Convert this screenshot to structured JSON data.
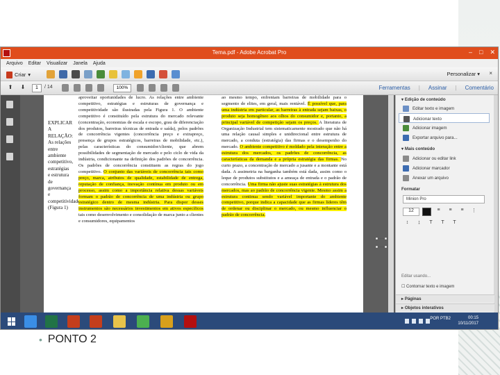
{
  "window": {
    "title": "Tema.pdf - Adobe Acrobat Pro"
  },
  "menu": [
    "Arquivo",
    "Editar",
    "Visualizar",
    "Janela",
    "Ajuda"
  ],
  "toolbar": {
    "create_label": "Criar",
    "personalize_label": "Personalizar",
    "close_symbol": "×"
  },
  "navigation": {
    "page_number": "1",
    "page_total": "/ 14",
    "zoom": "100%"
  },
  "panel_tabs": [
    "Ferramentas",
    "Assinar",
    "Comentário"
  ],
  "right_panel": {
    "section_edit": "Edição de conteúdo",
    "edit_items": [
      "Editar texto e imagem",
      "Adicionar texto",
      "Adicionar imagem",
      "Exportar arquivo para..."
    ],
    "section_more": "Mais conteúdo",
    "more_items": [
      "Adicionar ou editar link",
      "Adicionar marcador",
      "Anexar um arquivo"
    ],
    "format_label": "Formatar",
    "font_name": "Minion Pro",
    "font_size": "12",
    "aux_label": "Editar usando...",
    "constrain_label": "Contornar texto e imagem",
    "section_pages": "Páginas",
    "section_interactive": "Objetos interativos"
  },
  "document": {
    "side_label": "EXPLICAR A RELAÇÃO: As relações entre ambiente competitivo, estratégias e estrutura de governança e competitividade (Figura 1)",
    "col_a": [
      {
        "t": "aproveitar oportunidades de lucro.",
        "h": false
      },
      {
        "t": "As relações entre ambiente competitivo, estratégias e estruturas de governança e competitividade são ilustradas pela Figura 1. O ambiente competitivo é constituído pela estrutura do mercado relevante (concentração, economias de escala e escopo, grau de diferenciação dos produtos, barreiras técnicas de entrada e saída), pelos padrões de concorrência vigentes (concorrência preço e extrapreço, presença de grupos estratégicos, barreiras de mobilidade, etc.), pelas características do consumidor/cliente, que abrem possibilidades de segmentação de mercado e pelo ciclo de vida da indústria, condicionante na definição dos padrões de concorrência.",
        "h": false
      },
      {
        "t": "Os padrões de concorrência constituem as regras do jogo competitivo.",
        "h": false
      },
      {
        "t": "O conjunto das variáveis de concorrência tais como preço, marca, atributos de qualidade, estabilidade de entrega, reputação de confiança, inovação contínua em produto ou em processo, assim como a importância relativa dessas variáveis formam o padrão de concorrência de uma indústria ou grupo estratégico dentro de mesma indústria.",
        "h": true
      },
      {
        "t": "Para dispor desses instrumentos são necessários investimentos em ativos específicos",
        "h": true
      },
      {
        "t": "tais como desenvolvimento e consolidação de marca junto a clientes e consumidores, equipamentos",
        "h": false
      }
    ],
    "col_b": [
      {
        "t": "ao mesmo tempo, enfrentam barreiras de mobilidade para o segmento de elites, em geral, mais rentável.",
        "h": false
      },
      {
        "t": "É possível que, para uma indústria em particular, as barreiras à entrada sejam baixas, o produto seja homogêneo aos olhos do consumidor e, portanto, a principal variável de competição sejam os preços.",
        "h": true
      },
      {
        "t": "A literatura de Organização Industrial tem sistematicamente mostrado que não há uma relação causal simples e unidirecional entre estrutura de mercado, a conduta (estratégia) das firmas e o desempenho do mercado.",
        "h": false
      },
      {
        "t": "O ambiente competitivo é moldado pela interação entre a estrutura dos mercados, os padrões de concorrência, as características da demanda e a própria estratégia das firmas.",
        "h": true
      },
      {
        "t": "No curto prazo, a concentração de mercado a jusante e a montante está dada. A assimetria na barganha também está dada, assim como o leque de produtos substitutos e a ameaça de entrada e o padrão de concorrência.",
        "h": false
      },
      {
        "t": "Uma firma não ajuste suas estratégias à estrutura dos mercados, mas ao padrão de concorrência vigente. Mesmo assim a estrutura continua sendo variável importante do ambiente competitivo, porque indica a capacidade que as firmas líderes têm de ordenar ou disciplinar o mercado, ou mesmo influenciar o padrão de concorrência.",
        "h": true
      }
    ]
  },
  "taskbar": {
    "time": "00:15",
    "date": "10/11/2017",
    "lang": "POR PTB2"
  },
  "slide": {
    "bullet_text": "PONTO 2"
  },
  "colors": {
    "acrobat_red": "#e04d1c",
    "highlight": "#fff200",
    "taskbar": "#2b4a7a"
  }
}
